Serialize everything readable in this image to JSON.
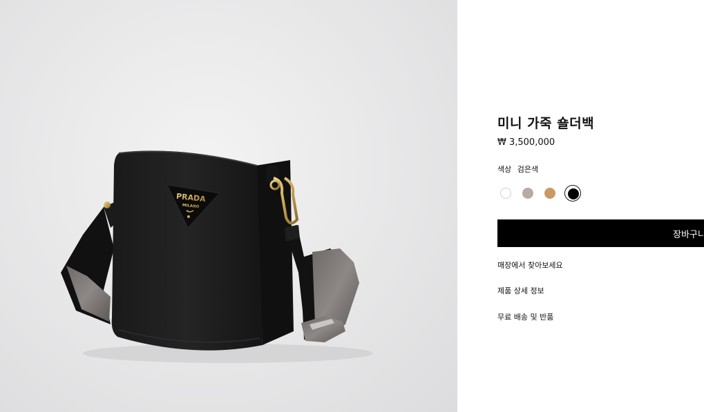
{
  "product": {
    "name": "미니 가죽 숄더백",
    "price": "₩ 3,500,000",
    "color_label": "색상",
    "color_value": "검은색",
    "image_logo_text": "PRADA",
    "image_logo_subtext": "MILANO"
  },
  "swatches": [
    {
      "name": "white",
      "color": "#ffffff",
      "selected": false
    },
    {
      "name": "taupe",
      "color": "#b7aba2",
      "selected": false
    },
    {
      "name": "caramel",
      "color": "#c99a66",
      "selected": false
    },
    {
      "name": "black",
      "color": "#000000",
      "selected": true
    }
  ],
  "actions": {
    "add_to_cart_label": "장바구니"
  },
  "links": {
    "find_in_store": "매장에서 찾아보세요",
    "product_details": "제품 상세 정보",
    "shipping_returns": "무료 배송 및 반품"
  },
  "colors": {
    "button_bg": "#000000",
    "panel_bg": "#ffffff"
  }
}
